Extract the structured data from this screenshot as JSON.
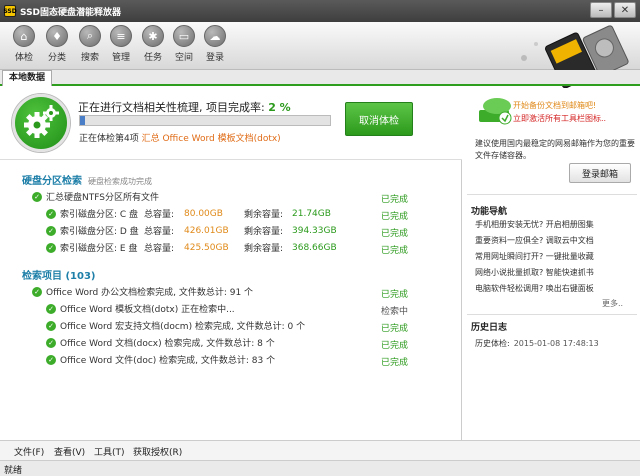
{
  "window": {
    "title": "SSD固态硬盘潜能释放器",
    "app_icon": "SSD"
  },
  "toolbar": [
    {
      "label": "体检",
      "icon": "stethoscope-icon",
      "glyph": "⌂"
    },
    {
      "label": "分类",
      "icon": "pin-icon",
      "glyph": "♦"
    },
    {
      "label": "搜索",
      "icon": "magnifier-icon",
      "glyph": "⌕"
    },
    {
      "label": "管理",
      "icon": "list-icon",
      "glyph": "≡"
    },
    {
      "label": "任务",
      "icon": "gear-icon",
      "glyph": "✱"
    },
    {
      "label": "空间",
      "icon": "disk-icon",
      "glyph": "▭"
    },
    {
      "label": "登录",
      "icon": "cloud-icon",
      "glyph": "☁"
    }
  ],
  "tabs": {
    "active": "本地数据"
  },
  "progress": {
    "status_prefix": "正在进行文档相关性梳理, 项目完成率: ",
    "percent_text": "2 %",
    "percent": 2,
    "checking_prefix": "正在体检第4项",
    "checking_file": "汇总 Office Word 模板文档(dotx)",
    "cancel_label": "取消体检"
  },
  "partition": {
    "title": "硬盘分区检索",
    "subtitle": "硬盘检索成功完成",
    "summary": "汇总硬盘NTFS分区所有文件",
    "summary_status": "已完成",
    "drives": [
      {
        "label": "索引磁盘分区: C 盘",
        "total_label": "总容量:",
        "total": "80.00GB",
        "free_label": "剩余容量:",
        "free": "21.74GB",
        "status": "已完成"
      },
      {
        "label": "索引磁盘分区: D 盘",
        "total_label": "总容量:",
        "total": "426.01GB",
        "free_label": "剩余容量:",
        "free": "394.33GB",
        "status": "已完成"
      },
      {
        "label": "索引磁盘分区: E 盘",
        "total_label": "总容量:",
        "total": "425.50GB",
        "free_label": "剩余容量:",
        "free": "368.66GB",
        "status": "已完成"
      }
    ]
  },
  "search": {
    "title": "检索项目 (103)",
    "summary": "Office Word 办公文档检索完成, 文件数总计: 91 个",
    "summary_status": "已完成",
    "items": [
      {
        "text": "Office Word 模板文档(dotx) 正在检索中...",
        "status": "检索中",
        "pending": true
      },
      {
        "text": "Office Word 宏支持文档(docm) 检索完成, 文件数总计: 0 个",
        "status": "已完成",
        "pending": false
      },
      {
        "text": "Office Word 文档(docx) 检索完成, 文件数总计: 8 个",
        "status": "已完成",
        "pending": false
      },
      {
        "text": "Office Word 文件(doc) 检索完成, 文件数总计: 83 个",
        "status": "已完成",
        "pending": false
      }
    ]
  },
  "side": {
    "promo_line1": "开始备份文档到邮箱吧!",
    "promo_line2": "立即激活所有工具栏图标..",
    "promo_desc": "建议使用国内最稳定的网易邮箱作为您的重要文件存储容器。",
    "login_label": "登录邮箱",
    "nav_title": "功能导航",
    "nav_items": [
      "手机相册安装无忧?  开启相册图集",
      "重要资料一应俱全?  调取云中文档",
      "常用网址瞬间打开?  一键批量收藏",
      "网络小说批量抓取?  智能快速抓书",
      "电脑软件轻松调用?  唤出右键面板"
    ],
    "nav_more": "更多..",
    "history_title": "历史日志",
    "history_label": "历史体检:",
    "history_time": "2015-01-08 17:48:13"
  },
  "menubar": [
    "文件(F)",
    "查看(V)",
    "工具(T)",
    "获取授权(R)"
  ],
  "status": {
    "ready": "就绪"
  },
  "colors": {
    "accent_green": "#2b9a1c",
    "header_blue": "#1e7fa8",
    "warn_orange": "#e08a1a",
    "alert_red": "#d42424"
  }
}
